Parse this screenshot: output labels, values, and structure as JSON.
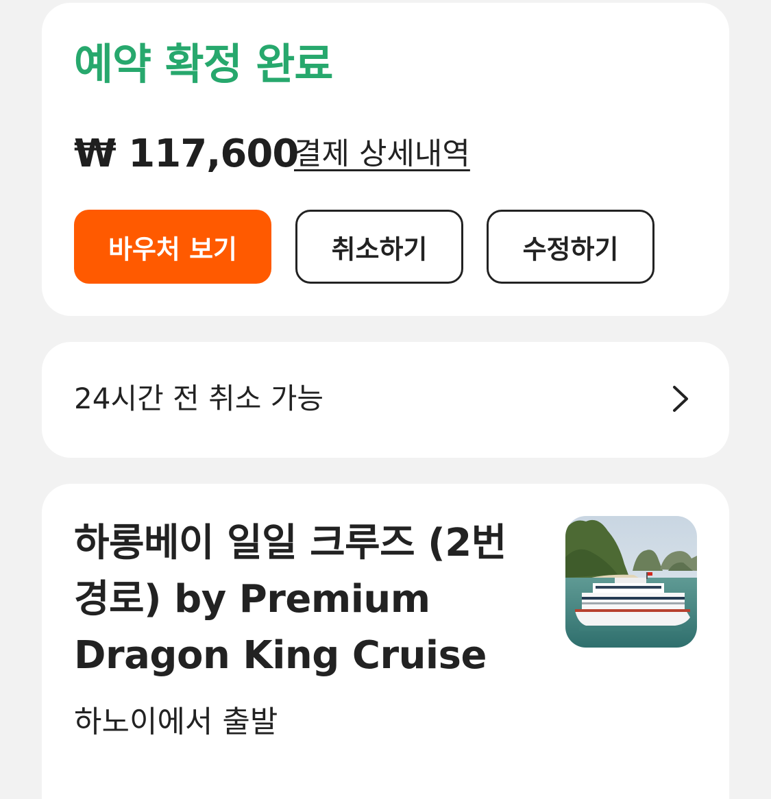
{
  "colors": {
    "status_green": "#27a86d",
    "primary_orange": "#ff5a00",
    "text_dark": "#222222",
    "background": "#f2f2f2",
    "card": "#ffffff"
  },
  "reservation": {
    "status": "예약 확정 완료",
    "price": "₩ 117,600",
    "payment_details_link": "결제 상세내역",
    "buttons": {
      "voucher": "바우처 보기",
      "cancel": "취소하기",
      "modify": "수정하기"
    }
  },
  "policy": {
    "text": "24시간 전 취소 가능",
    "icon": "chevron-right-icon"
  },
  "product": {
    "title": "하롱베이 일일 크루즈 (2번 경로) by Premium Dragon King Cruise",
    "departure": "하노이에서 출발",
    "thumbnail": "halong-bay-cruise-boat-photo"
  }
}
